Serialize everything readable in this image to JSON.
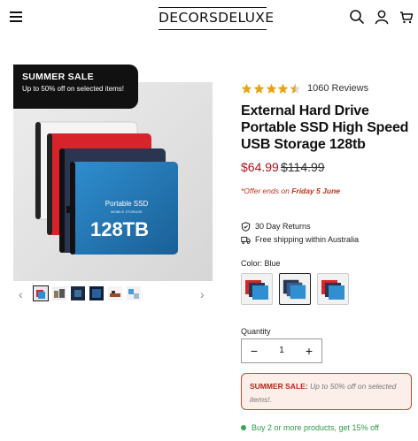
{
  "header": {
    "logo": "DECORSDELUXE",
    "icons": [
      "menu-icon",
      "search-icon",
      "account-icon",
      "cart-icon"
    ]
  },
  "promo_badge": {
    "title": "SUMMER SALE",
    "subtitle": "Up to 50% off on selected items!"
  },
  "gallery": {
    "image": {
      "label": "Portable SSD",
      "sublabel": "MOBILE STORAGE",
      "capacity": "128TB"
    },
    "thumbnail_count": 6,
    "active_thumbnail": 1
  },
  "product": {
    "rating": 4.5,
    "reviews": "1060 Reviews",
    "title": "External Hard Drive Portable SSD High Speed USB Storage 128tb",
    "price": "$64.99",
    "compare_price": "$114.99",
    "offer_prefix": "*Offer ends on",
    "offer_date": "Friday 5 June",
    "features": [
      {
        "icon": "shield-check-icon",
        "text": "30 Day Returns"
      },
      {
        "icon": "truck-icon",
        "text": "Free shipping within Australia"
      }
    ],
    "color_label": "Color: Blue",
    "color_swatches": 3,
    "selected_swatch": 2,
    "quantity_label": "Quantity",
    "quantity": "1",
    "qty_minus": "−",
    "qty_plus": "+"
  },
  "sale_notice": {
    "title": "SUMMER SALE:",
    "text": "Up to 50% off on selected items!."
  },
  "bundle_offer": "Buy 2 or more products, get 15% off",
  "colors": {
    "accent_red": "#b3121b",
    "sale_red": "#c0321c",
    "green": "#3aa550",
    "star": "#e8a317"
  }
}
